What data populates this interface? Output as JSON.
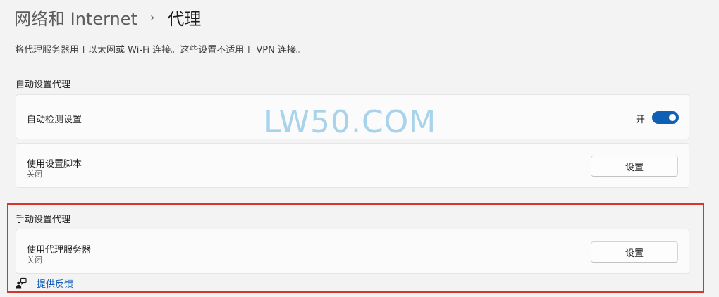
{
  "breadcrumb": {
    "parent": "网络和 Internet",
    "separator": "›",
    "current": "代理"
  },
  "description": "将代理服务器用于以太网或 Wi-Fi 连接。这些设置不适用于 VPN 连接。",
  "auto_section": {
    "title": "自动设置代理",
    "auto_detect": {
      "label": "自动检测设置",
      "toggle_state": "开",
      "toggle_on": true
    },
    "setup_script": {
      "label": "使用设置脚本",
      "status": "关闭",
      "button_label": "设置"
    }
  },
  "manual_section": {
    "title": "手动设置代理",
    "proxy_server": {
      "label": "使用代理服务器",
      "status": "关闭",
      "button_label": "设置"
    }
  },
  "feedback": {
    "icon": "feedback-person-icon",
    "label": "提供反馈"
  },
  "watermark": "LW50.COM",
  "colors": {
    "accent": "#0f5fb5",
    "highlight": "#d9342b",
    "link": "#0a5ab8",
    "watermark": "#a8d3ea"
  }
}
